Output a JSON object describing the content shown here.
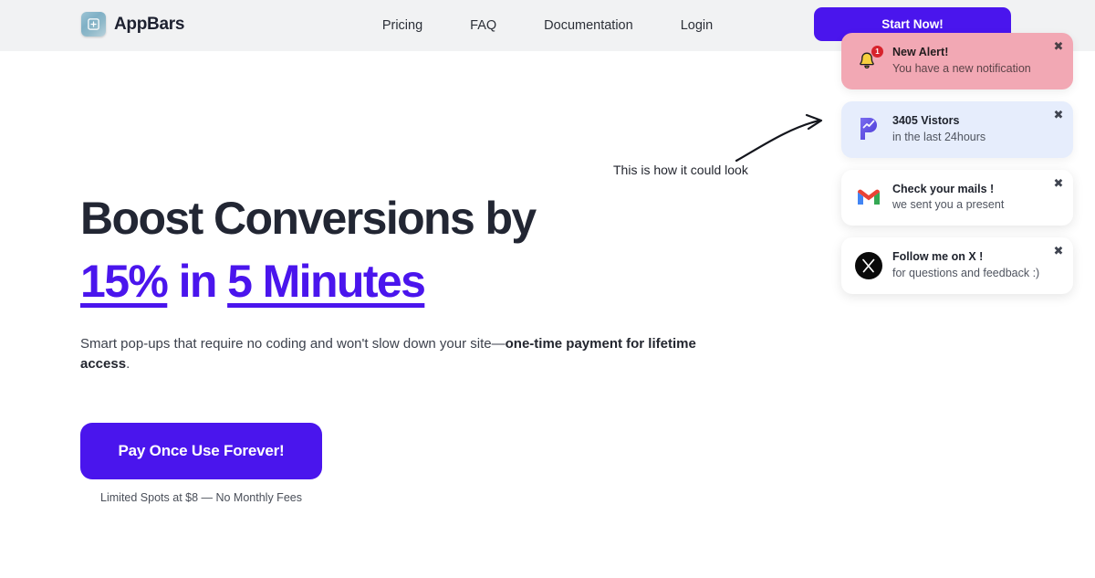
{
  "header": {
    "brand_name": "AppBars",
    "logo_icon": "square-plus-icon",
    "nav_links": [
      {
        "label": "Pricing"
      },
      {
        "label": "FAQ"
      },
      {
        "label": "Documentation"
      },
      {
        "label": "Login"
      }
    ],
    "cta_label": "Start Now!"
  },
  "hero": {
    "headline_line1": "Boost Conversions by",
    "headline_percent": "15%",
    "headline_in": " in ",
    "headline_minutes": "5 Minutes",
    "subhead_plain": "Smart pop-ups that require no coding and won't slow down your site—",
    "subhead_bold": "one-time payment for lifetime access",
    "subhead_end": ".",
    "cta_label": "Pay Once Use Forever!",
    "cta_note": "Limited Spots at $8 — No Monthly Fees"
  },
  "annotation": {
    "text": "This is how it could look",
    "arrow_icon": "curved-arrow-icon"
  },
  "notifications": [
    {
      "icon": "bell-icon",
      "badge": "1",
      "title": "New Alert!",
      "subtitle": "You have a new notification",
      "close_icon": "✖",
      "style": "pink"
    },
    {
      "icon": "plausible-analytics-icon",
      "title": "3405 Vistors",
      "subtitle": "in the last 24hours",
      "close_icon": "✖",
      "style": "blue"
    },
    {
      "icon": "gmail-icon",
      "title": "Check your mails !",
      "subtitle": "we sent you a present",
      "close_icon": "✖",
      "style": "white"
    },
    {
      "icon": "x-twitter-icon",
      "title": "Follow me on X !",
      "subtitle": "for questions and feedback :)",
      "close_icon": "✖",
      "style": "white"
    }
  ],
  "colors": {
    "accent_purple": "#4a15ed",
    "header_bg": "#f1f2f3",
    "heading_dark": "#222633",
    "pink_card": "#f2a8b4",
    "blue_card": "#e6edfc",
    "badge_red": "#d7232c"
  }
}
